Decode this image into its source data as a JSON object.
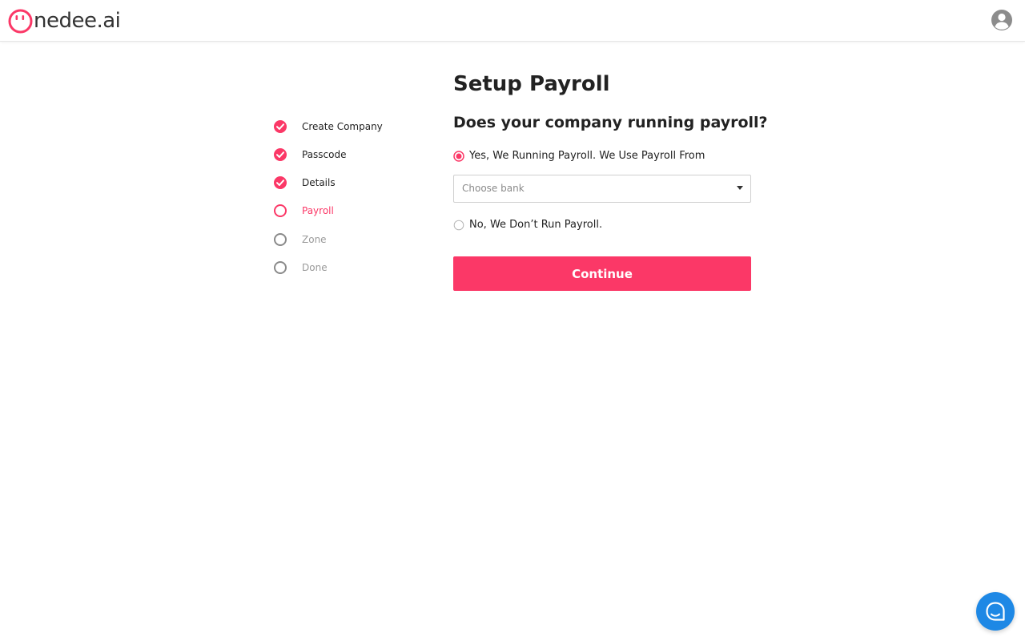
{
  "brand": {
    "name": "nedee.ai",
    "accent_color": "#fb3867",
    "chat_color": "#1e88e5"
  },
  "header": {
    "user_icon": "user-circle-icon"
  },
  "steps": [
    {
      "label": "Create Company",
      "status": "done"
    },
    {
      "label": "Passcode",
      "status": "done"
    },
    {
      "label": "Details",
      "status": "done"
    },
    {
      "label": "Payroll",
      "status": "active"
    },
    {
      "label": "Zone",
      "status": "pending"
    },
    {
      "label": "Done",
      "status": "pending"
    }
  ],
  "main": {
    "title": "Setup Payroll",
    "question": "Does your company running payroll?",
    "option_yes": "Yes, We Running Payroll. We Use Payroll From",
    "option_yes_selected": true,
    "bank_select": {
      "placeholder": "Choose bank",
      "value": ""
    },
    "option_no": "No, We Don’t Run Payroll.",
    "option_no_selected": false,
    "continue_label": "Continue"
  },
  "chat_widget": {
    "icon": "chat-bubble-icon"
  }
}
